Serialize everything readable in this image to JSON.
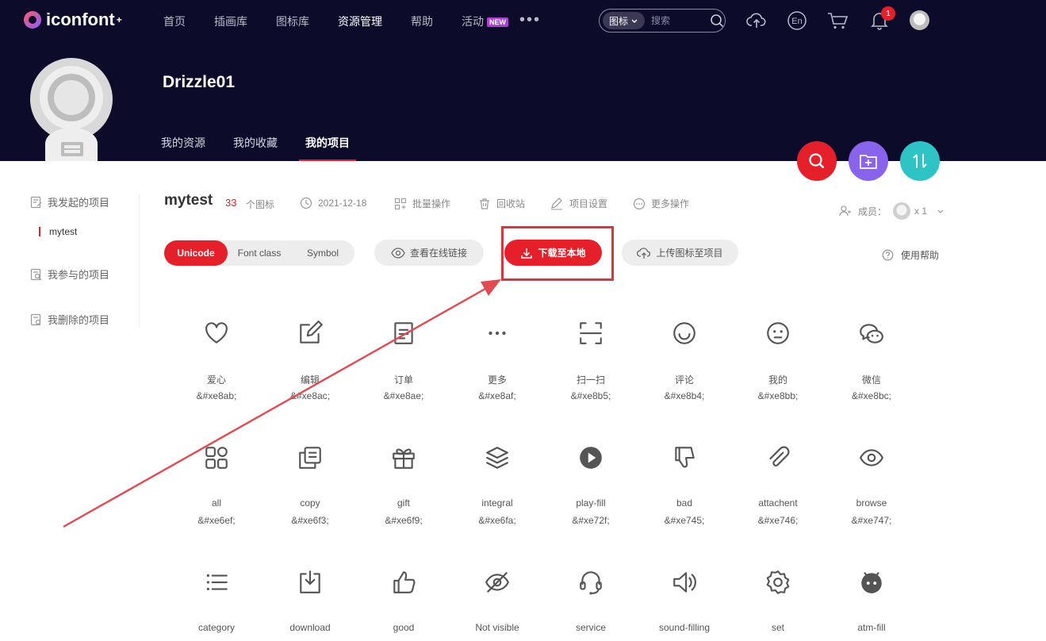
{
  "brand": {
    "logo_text": "iconfont",
    "logo_sup": "+"
  },
  "nav": {
    "items": [
      "首页",
      "插画库",
      "图标库",
      "资源管理",
      "帮助",
      "活动"
    ],
    "active": "资源管理",
    "new_badge": "NEW",
    "more": "•••"
  },
  "search": {
    "type_label": "图标",
    "placeholder": "搜索"
  },
  "notifications": {
    "count": "1"
  },
  "profile": {
    "username": "Drizzle01",
    "tabs": [
      "我的资源",
      "我的收藏",
      "我的项目"
    ],
    "active_tab": "我的项目"
  },
  "sidebar": {
    "items": [
      "我发起的项目",
      "我参与的项目",
      "我删除的项目"
    ],
    "sub_item": "mytest"
  },
  "project": {
    "name": "mytest",
    "count": "33",
    "count_label": "个图标",
    "date": "2021-12-18",
    "batch": "批量操作",
    "recycle": "回收站",
    "settings": "项目设置",
    "more_ops": "更多操作",
    "members_label": "成员：",
    "members_count": "x 1"
  },
  "toolbar": {
    "modes": [
      "Unicode",
      "Font class",
      "Symbol"
    ],
    "active_mode": "Unicode",
    "view_online": "查看在线链接",
    "download": "下载至本地",
    "upload": "上传图标至项目",
    "help": "使用帮助"
  },
  "colors": {
    "header_bg": "#0d0b2a",
    "accent": "#e5202a",
    "fab_red": "#e5202a",
    "fab_purple": "#8a63ec",
    "fab_teal": "#2ec4c6"
  },
  "icons": [
    {
      "name": "爱心",
      "code": "&#xe8ab;",
      "icon": "heart-icon"
    },
    {
      "name": "编辑",
      "code": "&#xe8ac;",
      "icon": "edit-icon"
    },
    {
      "name": "订单",
      "code": "&#xe8ae;",
      "icon": "order-icon"
    },
    {
      "name": "更多",
      "code": "&#xe8af;",
      "icon": "more-icon"
    },
    {
      "name": "扫一扫",
      "code": "&#xe8b5;",
      "icon": "scan-icon"
    },
    {
      "name": "评论",
      "code": "&#xe8b4;",
      "icon": "comment-icon"
    },
    {
      "name": "我的",
      "code": "&#xe8bb;",
      "icon": "mine-icon"
    },
    {
      "name": "微信",
      "code": "&#xe8bc;",
      "icon": "wechat-icon"
    },
    {
      "name": "all",
      "code": "&#xe6ef;",
      "icon": "all-icon"
    },
    {
      "name": "copy",
      "code": "&#xe6f3;",
      "icon": "copy-icon"
    },
    {
      "name": "gift",
      "code": "&#xe6f9;",
      "icon": "gift-icon"
    },
    {
      "name": "integral",
      "code": "&#xe6fa;",
      "icon": "integral-icon"
    },
    {
      "name": "play-fill",
      "code": "&#xe72f;",
      "icon": "play-fill-icon"
    },
    {
      "name": "bad",
      "code": "&#xe745;",
      "icon": "bad-icon"
    },
    {
      "name": "attachent",
      "code": "&#xe746;",
      "icon": "attachment-icon"
    },
    {
      "name": "browse",
      "code": "&#xe747;",
      "icon": "browse-icon"
    },
    {
      "name": "category",
      "code": "",
      "icon": "category-icon"
    },
    {
      "name": "download",
      "code": "",
      "icon": "download-icon"
    },
    {
      "name": "good",
      "code": "",
      "icon": "good-icon"
    },
    {
      "name": "Not visible",
      "code": "",
      "icon": "not-visible-icon"
    },
    {
      "name": "service",
      "code": "",
      "icon": "service-icon"
    },
    {
      "name": "sound-filling",
      "code": "",
      "icon": "sound-filling-icon"
    },
    {
      "name": "set",
      "code": "",
      "icon": "set-icon"
    },
    {
      "name": "atm-fill",
      "code": "",
      "icon": "atm-fill-icon"
    }
  ]
}
